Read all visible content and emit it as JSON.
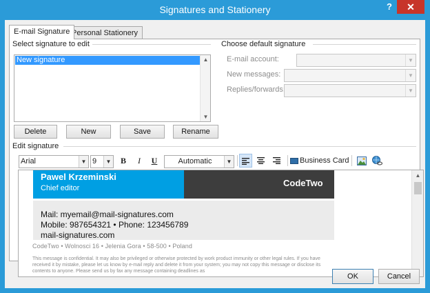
{
  "window": {
    "title": "Signatures and Stationery",
    "help": "?",
    "close": "✕"
  },
  "tabs": [
    {
      "label": "E-mail Signature"
    },
    {
      "label": "Personal Stationery"
    }
  ],
  "select_section": {
    "label": "Select signature to edit",
    "items": [
      "New signature"
    ]
  },
  "buttons": {
    "delete": "Delete",
    "new": "New",
    "save": "Save",
    "rename": "Rename"
  },
  "default_section": {
    "label": "Choose default signature",
    "email_account_label": "E-mail account:",
    "new_messages_label": "New messages:",
    "replies_label": "Replies/forwards:"
  },
  "edit_section": {
    "label": "Edit signature",
    "font": "Arial",
    "size": "9",
    "bold": "B",
    "italic": "I",
    "underline": "U",
    "color": "Automatic",
    "business_card": "Business Card"
  },
  "signature": {
    "name": "Pawel Krzeminski",
    "role": "Chief editor",
    "brand": "CodeTwo",
    "mail": "Mail: myemail@mail-signatures.com",
    "phones": "Mobile: 987654321 • Phone: 123456789",
    "website": "mail-signatures.com",
    "address": "CodeTwo • Wolnosci 16 • Jelenia Gora • 58-500 • Poland",
    "disclaimer": "This message is confidential. It may also be privileged or otherwise protected by work product immunity or other legal rules. If you have received it by mistake, please let us know by e-mail reply and delete it from your system; you may not copy this message or disclose its contents to anyone. Please send us by fax any message containing deadlines as"
  },
  "footer": {
    "ok": "OK",
    "cancel": "Cancel"
  },
  "colors": {
    "titlebar": "#2b9bd8",
    "close": "#c7352a",
    "sig_blue": "#009fe3",
    "sig_dark": "#3d3d3d"
  }
}
